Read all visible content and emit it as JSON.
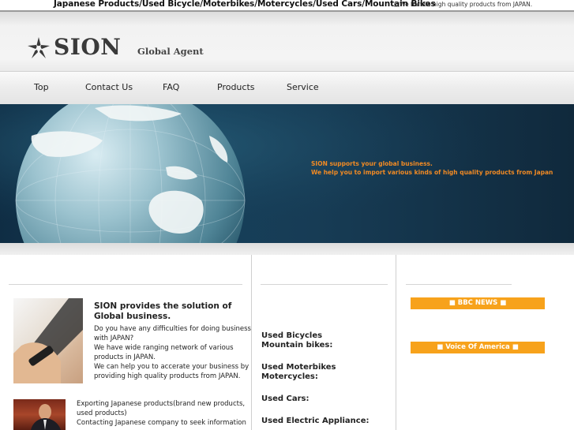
{
  "topbar": {
    "headline": "Japanese Products/Used Bicycle/Moterbikes/Motercycles/Used Cars/Mountain Bikes",
    "tagline": "□We handle high quality products from JAPAN."
  },
  "logo": {
    "name": "SION",
    "subtitle": "Global Agent"
  },
  "nav": {
    "items": [
      "Top",
      "Contact Us",
      "FAQ",
      "Products",
      "Service"
    ]
  },
  "hero": {
    "line1": "SION supports your global business.",
    "line2": "We help you to import various kinds of high quality products from Japan"
  },
  "intro": {
    "title": "SION provides the solution of Global business.",
    "body": [
      "Do you have any difficulties for doing business",
      "with JAPAN?",
      "We have wide ranging network of various",
      "products in JAPAN.",
      "We can help you to accerate your business by",
      "providing high quality products from JAPAN."
    ]
  },
  "services": {
    "body": [
      "Exporting Japanese products(brand new products,",
      "used products)",
      "Contacting Japanese company to seek information"
    ]
  },
  "categories": {
    "bicycles": "Used Bicycles",
    "mountain": "Mountain bikes:",
    "moterbikes": "Used Moterbikes",
    "motercycles": "Motercycles:",
    "cars": "Used Cars:",
    "appliance": "Used Electric Appliance:"
  },
  "sidebar": {
    "bbc": "■ BBC NEWS ■",
    "voa": "■ Voice Of America ■"
  },
  "colors": {
    "accent_orange": "#f7a21b",
    "hero_text": "#f08a24",
    "hero_bg": "#16405b"
  }
}
